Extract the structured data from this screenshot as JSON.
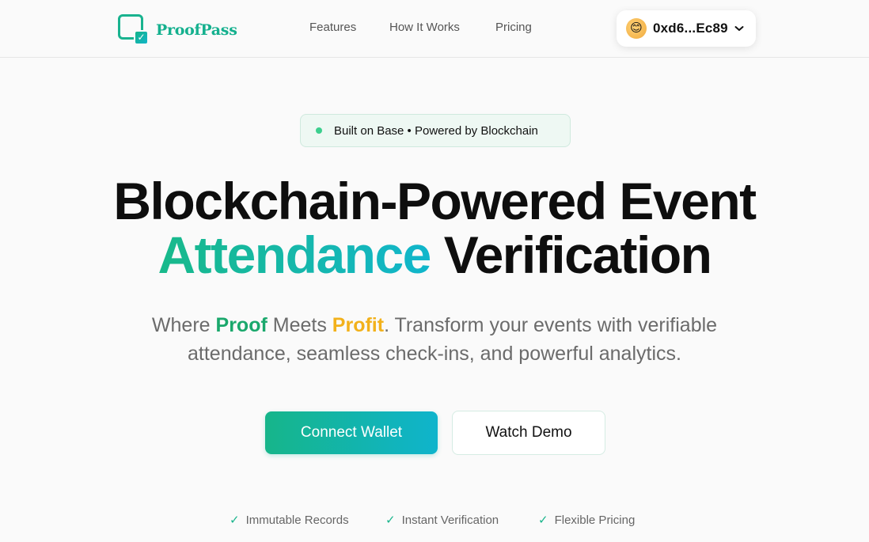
{
  "header": {
    "brand": "ProofPass",
    "nav": [
      "Features",
      "How It Works",
      "Pricing"
    ],
    "wallet": {
      "address": "0xd6...Ec89",
      "avatar_icon": "emoji-avatar-icon"
    }
  },
  "hero": {
    "badge": "Built on Base • Powered by Blockchain",
    "title_line1": "Blockchain-Powered Event",
    "title_line2_accent": "Attendance",
    "title_line2_rest": "Verification",
    "subtitle": {
      "where": "Where",
      "proof": "Proof",
      "meets": "Meets",
      "profit": "Profit",
      "rest1": ". Transform your events with verifiable",
      "line2": "attendance, seamless check-ins, and powerful analytics."
    },
    "primary_cta": "Connect Wallet",
    "secondary_cta": "Watch Demo",
    "features": [
      "Immutable Records",
      "Instant Verification",
      "Flexible Pricing"
    ],
    "check_glyph": "✓"
  },
  "colors": {
    "brand": "#14b08e",
    "gradient_start": "#16b58a",
    "gradient_end": "#0fb4cc",
    "accent_yellow": "#f2b11b",
    "accent_green": "#1aa86c"
  }
}
